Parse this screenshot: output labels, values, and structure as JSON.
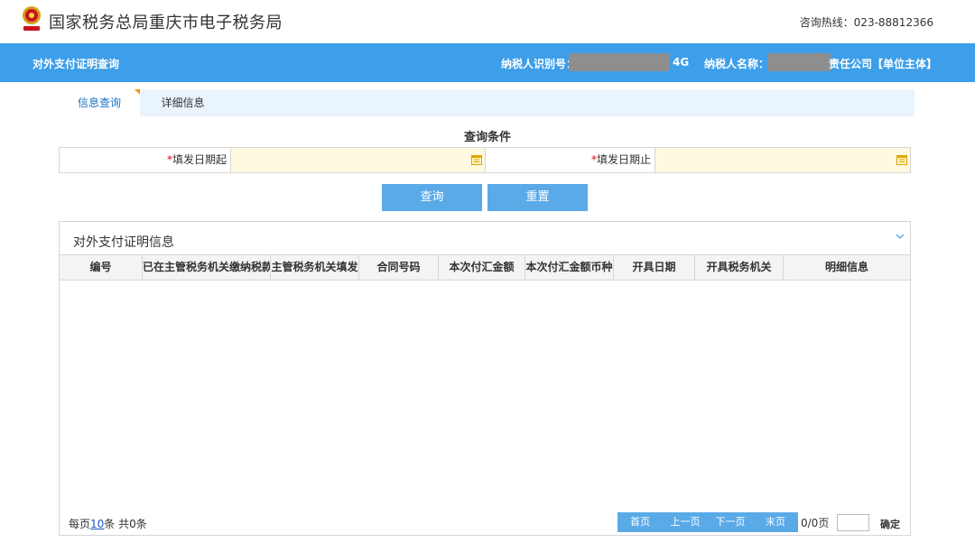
{
  "header": {
    "title": "国家税务总局重庆市电子税务局",
    "hotline": "咨询热线：023-88812366"
  },
  "bar": {
    "page_name": "对外支付证明查询",
    "taxpayer_id_label": "纳税人识别号：",
    "taxpayer_id_suffix": "4G",
    "taxpayer_name_label": "纳税人名称：",
    "taxpayer_name_suffix": "责任公司【单位主体】"
  },
  "tabs": [
    {
      "label": "信息查询"
    },
    {
      "label": "详细信息"
    }
  ],
  "query": {
    "title": "查询条件",
    "required_mark": "*",
    "date_from_label": "填发日期起",
    "date_from_value": "",
    "date_to_label": "填发日期止",
    "date_to_value": "",
    "query_button": "查询",
    "reset_button": "重置"
  },
  "results": {
    "title": "对外支付证明信息",
    "columns": [
      "编号",
      "已在主管税务机关缴纳税款",
      "主管税务机关填发",
      "合同号码",
      "本次付汇金额",
      "本次付汇金额币种",
      "开具日期",
      "开具税务机关",
      "明细信息"
    ],
    "rows": []
  },
  "pager": {
    "per_page_prefix": "每页",
    "per_page_value": "10",
    "per_page_suffix": "条 共0条",
    "first": "首页",
    "prev": "上一页",
    "next": "下一页",
    "last": "末页",
    "page_count": "0/0页",
    "goto_value": "",
    "confirm": "确定"
  },
  "colors": {
    "accent_blue": "#3d9ee9",
    "button_blue": "#5aaae8",
    "input_yellow": "#fff9e0",
    "required_red": "#e60012"
  },
  "icons": {
    "emblem": "tax-emblem-icon",
    "calendar": "calendar-icon",
    "collapse": "chevron-down-icon"
  }
}
